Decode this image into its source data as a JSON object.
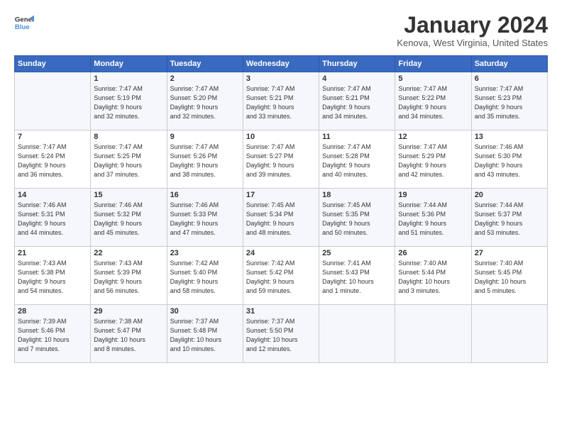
{
  "header": {
    "logo_general": "General",
    "logo_blue": "Blue",
    "month_title": "January 2024",
    "location": "Kenova, West Virginia, United States"
  },
  "days_of_week": [
    "Sunday",
    "Monday",
    "Tuesday",
    "Wednesday",
    "Thursday",
    "Friday",
    "Saturday"
  ],
  "weeks": [
    [
      {
        "day": "",
        "info": ""
      },
      {
        "day": "1",
        "info": "Sunrise: 7:47 AM\nSunset: 5:19 PM\nDaylight: 9 hours\nand 32 minutes."
      },
      {
        "day": "2",
        "info": "Sunrise: 7:47 AM\nSunset: 5:20 PM\nDaylight: 9 hours\nand 32 minutes."
      },
      {
        "day": "3",
        "info": "Sunrise: 7:47 AM\nSunset: 5:21 PM\nDaylight: 9 hours\nand 33 minutes."
      },
      {
        "day": "4",
        "info": "Sunrise: 7:47 AM\nSunset: 5:21 PM\nDaylight: 9 hours\nand 34 minutes."
      },
      {
        "day": "5",
        "info": "Sunrise: 7:47 AM\nSunset: 5:22 PM\nDaylight: 9 hours\nand 34 minutes."
      },
      {
        "day": "6",
        "info": "Sunrise: 7:47 AM\nSunset: 5:23 PM\nDaylight: 9 hours\nand 35 minutes."
      }
    ],
    [
      {
        "day": "7",
        "info": "Sunrise: 7:47 AM\nSunset: 5:24 PM\nDaylight: 9 hours\nand 36 minutes."
      },
      {
        "day": "8",
        "info": "Sunrise: 7:47 AM\nSunset: 5:25 PM\nDaylight: 9 hours\nand 37 minutes."
      },
      {
        "day": "9",
        "info": "Sunrise: 7:47 AM\nSunset: 5:26 PM\nDaylight: 9 hours\nand 38 minutes."
      },
      {
        "day": "10",
        "info": "Sunrise: 7:47 AM\nSunset: 5:27 PM\nDaylight: 9 hours\nand 39 minutes."
      },
      {
        "day": "11",
        "info": "Sunrise: 7:47 AM\nSunset: 5:28 PM\nDaylight: 9 hours\nand 40 minutes."
      },
      {
        "day": "12",
        "info": "Sunrise: 7:47 AM\nSunset: 5:29 PM\nDaylight: 9 hours\nand 42 minutes."
      },
      {
        "day": "13",
        "info": "Sunrise: 7:46 AM\nSunset: 5:30 PM\nDaylight: 9 hours\nand 43 minutes."
      }
    ],
    [
      {
        "day": "14",
        "info": "Sunrise: 7:46 AM\nSunset: 5:31 PM\nDaylight: 9 hours\nand 44 minutes."
      },
      {
        "day": "15",
        "info": "Sunrise: 7:46 AM\nSunset: 5:32 PM\nDaylight: 9 hours\nand 45 minutes."
      },
      {
        "day": "16",
        "info": "Sunrise: 7:46 AM\nSunset: 5:33 PM\nDaylight: 9 hours\nand 47 minutes."
      },
      {
        "day": "17",
        "info": "Sunrise: 7:45 AM\nSunset: 5:34 PM\nDaylight: 9 hours\nand 48 minutes."
      },
      {
        "day": "18",
        "info": "Sunrise: 7:45 AM\nSunset: 5:35 PM\nDaylight: 9 hours\nand 50 minutes."
      },
      {
        "day": "19",
        "info": "Sunrise: 7:44 AM\nSunset: 5:36 PM\nDaylight: 9 hours\nand 51 minutes."
      },
      {
        "day": "20",
        "info": "Sunrise: 7:44 AM\nSunset: 5:37 PM\nDaylight: 9 hours\nand 53 minutes."
      }
    ],
    [
      {
        "day": "21",
        "info": "Sunrise: 7:43 AM\nSunset: 5:38 PM\nDaylight: 9 hours\nand 54 minutes."
      },
      {
        "day": "22",
        "info": "Sunrise: 7:43 AM\nSunset: 5:39 PM\nDaylight: 9 hours\nand 56 minutes."
      },
      {
        "day": "23",
        "info": "Sunrise: 7:42 AM\nSunset: 5:40 PM\nDaylight: 9 hours\nand 58 minutes."
      },
      {
        "day": "24",
        "info": "Sunrise: 7:42 AM\nSunset: 5:42 PM\nDaylight: 9 hours\nand 59 minutes."
      },
      {
        "day": "25",
        "info": "Sunrise: 7:41 AM\nSunset: 5:43 PM\nDaylight: 10 hours\nand 1 minute."
      },
      {
        "day": "26",
        "info": "Sunrise: 7:40 AM\nSunset: 5:44 PM\nDaylight: 10 hours\nand 3 minutes."
      },
      {
        "day": "27",
        "info": "Sunrise: 7:40 AM\nSunset: 5:45 PM\nDaylight: 10 hours\nand 5 minutes."
      }
    ],
    [
      {
        "day": "28",
        "info": "Sunrise: 7:39 AM\nSunset: 5:46 PM\nDaylight: 10 hours\nand 7 minutes."
      },
      {
        "day": "29",
        "info": "Sunrise: 7:38 AM\nSunset: 5:47 PM\nDaylight: 10 hours\nand 8 minutes."
      },
      {
        "day": "30",
        "info": "Sunrise: 7:37 AM\nSunset: 5:48 PM\nDaylight: 10 hours\nand 10 minutes."
      },
      {
        "day": "31",
        "info": "Sunrise: 7:37 AM\nSunset: 5:50 PM\nDaylight: 10 hours\nand 12 minutes."
      },
      {
        "day": "",
        "info": ""
      },
      {
        "day": "",
        "info": ""
      },
      {
        "day": "",
        "info": ""
      }
    ]
  ]
}
